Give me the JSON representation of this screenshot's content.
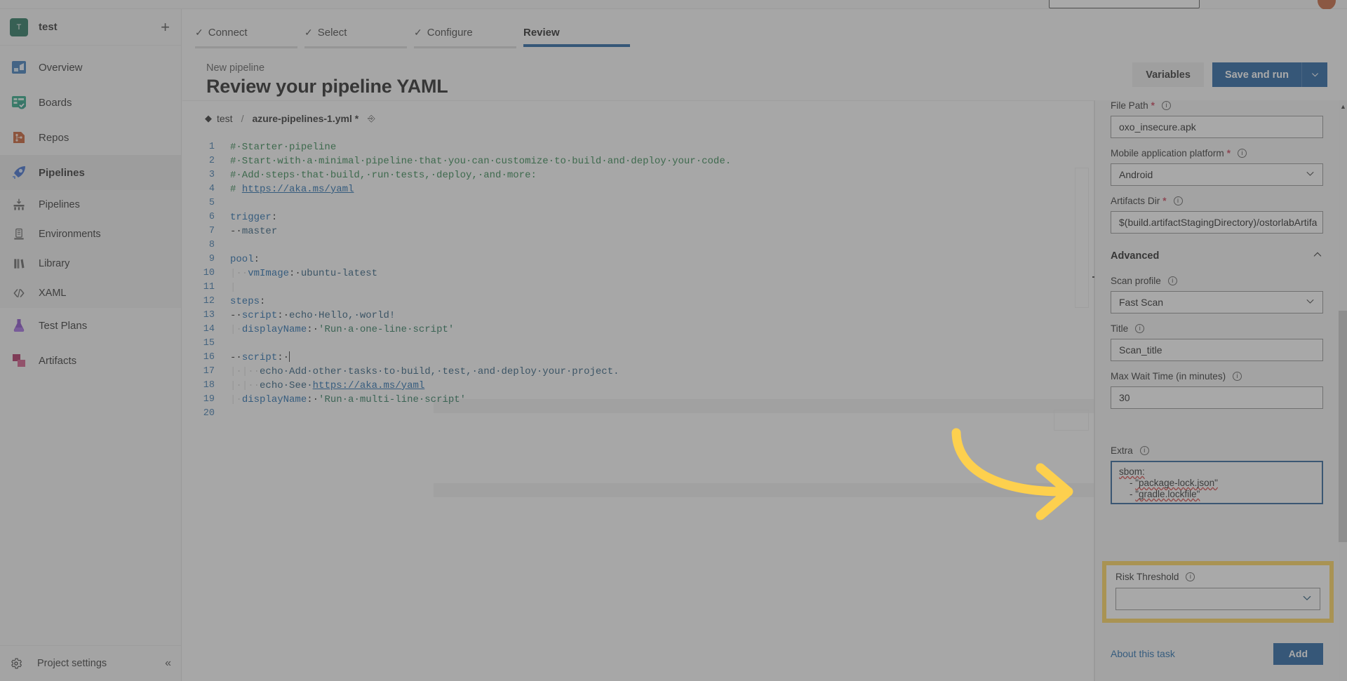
{
  "topbar": {
    "search_placeholder": ""
  },
  "sidebar": {
    "project": {
      "initial": "T",
      "name": "test",
      "add_label": "+"
    },
    "items": [
      {
        "label": "Overview",
        "icon": "overview-icon"
      },
      {
        "label": "Boards",
        "icon": "boards-icon"
      },
      {
        "label": "Repos",
        "icon": "repos-icon"
      },
      {
        "label": "Pipelines",
        "icon": "pipelines-icon",
        "active": true
      },
      {
        "label": "Pipelines",
        "icon": "pipelines-sub-icon",
        "sub": true
      },
      {
        "label": "Environments",
        "icon": "environments-icon",
        "sub": true
      },
      {
        "label": "Library",
        "icon": "library-icon",
        "sub": true
      },
      {
        "label": "XAML",
        "icon": "xaml-icon",
        "sub": true
      },
      {
        "label": "Test Plans",
        "icon": "test-plans-icon"
      },
      {
        "label": "Artifacts",
        "icon": "artifacts-icon"
      }
    ],
    "footer": {
      "label": "Project settings",
      "collapse": "«"
    }
  },
  "wizard": {
    "tabs": [
      {
        "label": "Connect",
        "done": true
      },
      {
        "label": "Select",
        "done": true
      },
      {
        "label": "Configure",
        "done": true
      },
      {
        "label": "Review",
        "done": false,
        "current": true
      }
    ],
    "check": "✓"
  },
  "page": {
    "kicker": "New pipeline",
    "title": "Review your pipeline YAML",
    "variables_label": "Variables",
    "save_and_run_label": "Save and run"
  },
  "editor": {
    "breadcrumb": {
      "repo": "test",
      "separator": "/",
      "file": "azure-pipelines-1.yml *"
    },
    "lines": [
      {
        "n": 1,
        "text": "# Starter pipeline"
      },
      {
        "n": 2,
        "text": "# Start with a minimal pipeline that you can customize to build and deploy your code."
      },
      {
        "n": 3,
        "text": "# Add steps that build, run tests, deploy, and more:"
      },
      {
        "n": 4,
        "text": "# https://aka.ms/yaml"
      },
      {
        "n": 5,
        "text": ""
      },
      {
        "n": 6,
        "text": "trigger:"
      },
      {
        "n": 7,
        "text": "- master"
      },
      {
        "n": 8,
        "text": ""
      },
      {
        "n": 9,
        "text": "pool:"
      },
      {
        "n": 10,
        "text": "  vmImage: ubuntu-latest"
      },
      {
        "n": 11,
        "text": ""
      },
      {
        "n": 12,
        "text": "steps:"
      },
      {
        "n": 13,
        "text": "- script: echo Hello, world!"
      },
      {
        "n": 14,
        "text": "  displayName: 'Run a one-line script'"
      },
      {
        "n": 15,
        "text": ""
      },
      {
        "n": 16,
        "text": "- script: |"
      },
      {
        "n": 17,
        "text": "      echo Add other tasks to build, test, and deploy your project."
      },
      {
        "n": 18,
        "text": "      echo See https://aka.ms/yaml"
      },
      {
        "n": 19,
        "text": "  displayName: 'Run a multi-line script'"
      },
      {
        "n": 20,
        "text": ""
      }
    ]
  },
  "task_panel": {
    "fields": {
      "file_path": {
        "label": "File Path",
        "required": true,
        "value": "oxo_insecure.apk"
      },
      "platform": {
        "label": "Mobile application platform",
        "required": true,
        "value": "Android"
      },
      "artifacts_dir": {
        "label": "Artifacts Dir",
        "required": true,
        "value": "$(build.artifactStagingDirectory)/ostorlabArtifa"
      },
      "scan_profile": {
        "label": "Scan profile",
        "value": "Fast Scan"
      },
      "title": {
        "label": "Title",
        "value": "Scan_title"
      },
      "max_wait": {
        "label": "Max Wait Time (in minutes)",
        "value": "30"
      },
      "risk_threshold": {
        "label": "Risk Threshold",
        "value": ""
      },
      "extra": {
        "label": "Extra",
        "value": "sbom:\n    - \"package-lock.json\"\n    - \"gradle.lockfile\""
      }
    },
    "advanced_label": "Advanced",
    "about_label": "About this task",
    "add_label": "Add"
  },
  "colors": {
    "accent": "#10559a",
    "highlight": "#ffd14d",
    "required": "#c4314b",
    "link": "#0f5fa6",
    "comment": "#1f7a3f"
  }
}
